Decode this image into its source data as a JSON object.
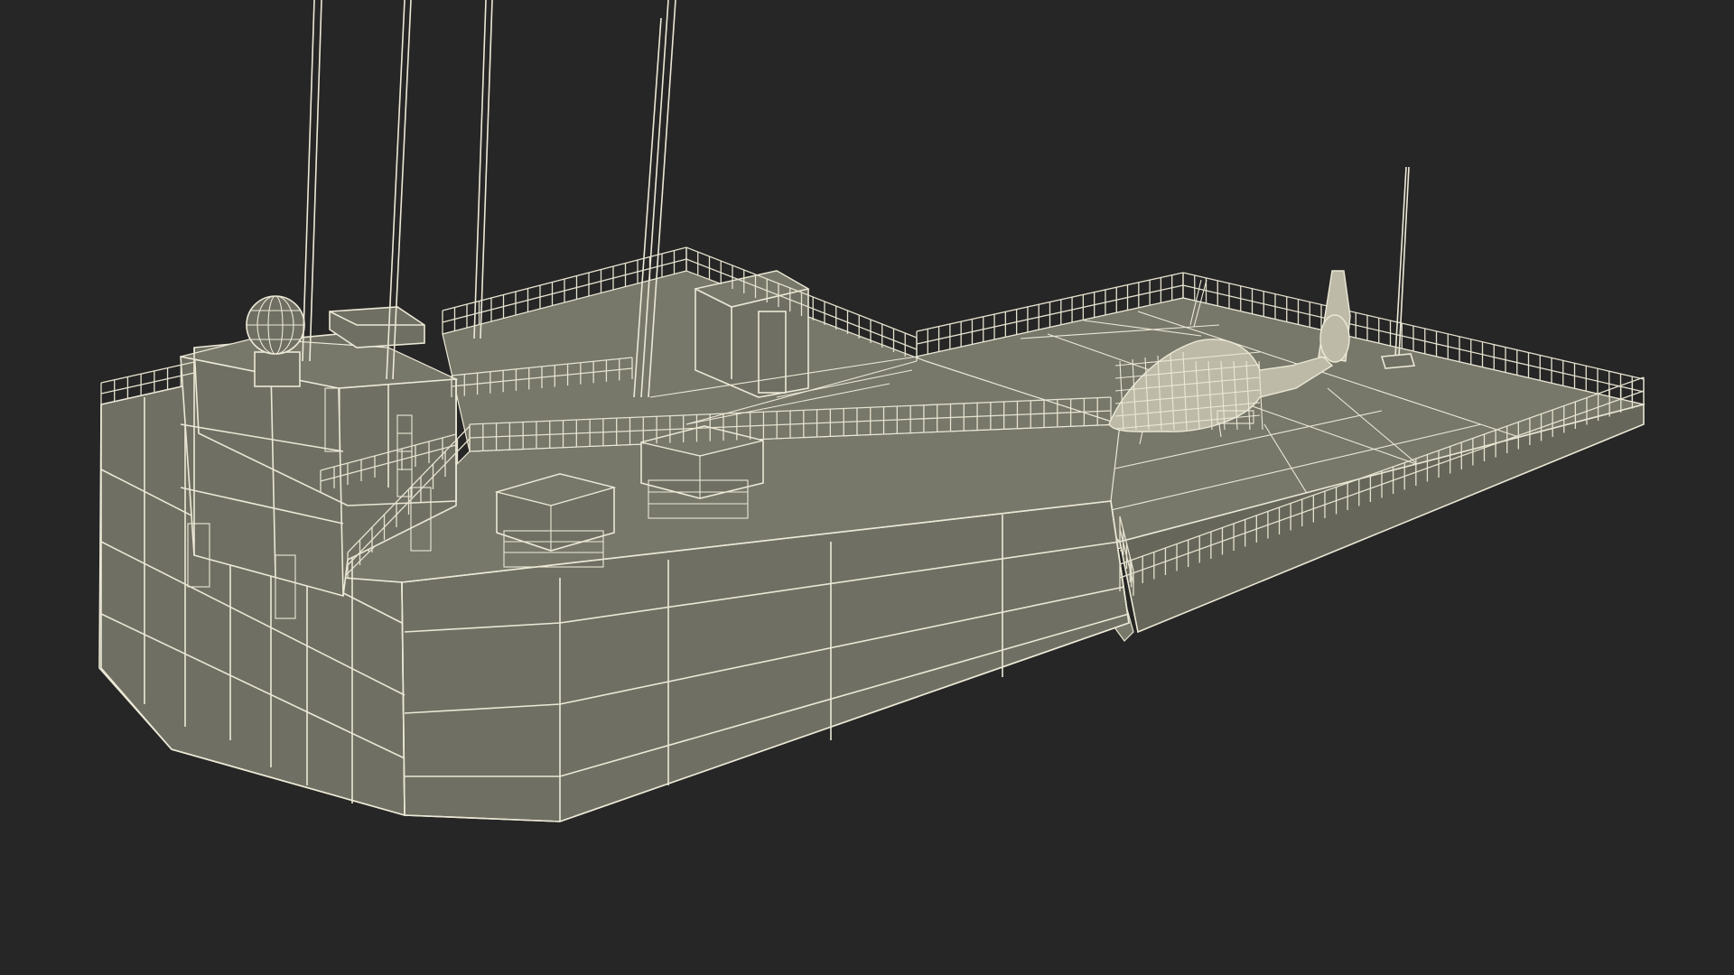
{
  "scene": {
    "subject": "ship-stern-section-wireframe",
    "colors": {
      "background": "#262626",
      "hull_fill": "#6f6f63",
      "hull_fill_dark": "#66665a",
      "deck_fill": "#77776a",
      "wire": "#ece8d6",
      "wire_dim": "#d9d5c2"
    },
    "objects": [
      "hull",
      "deckhouse",
      "radar-dome",
      "mast-antennas",
      "missile-launchers",
      "crane-unit",
      "helipad-deck",
      "helicopter",
      "railings",
      "whip-antenna"
    ]
  }
}
